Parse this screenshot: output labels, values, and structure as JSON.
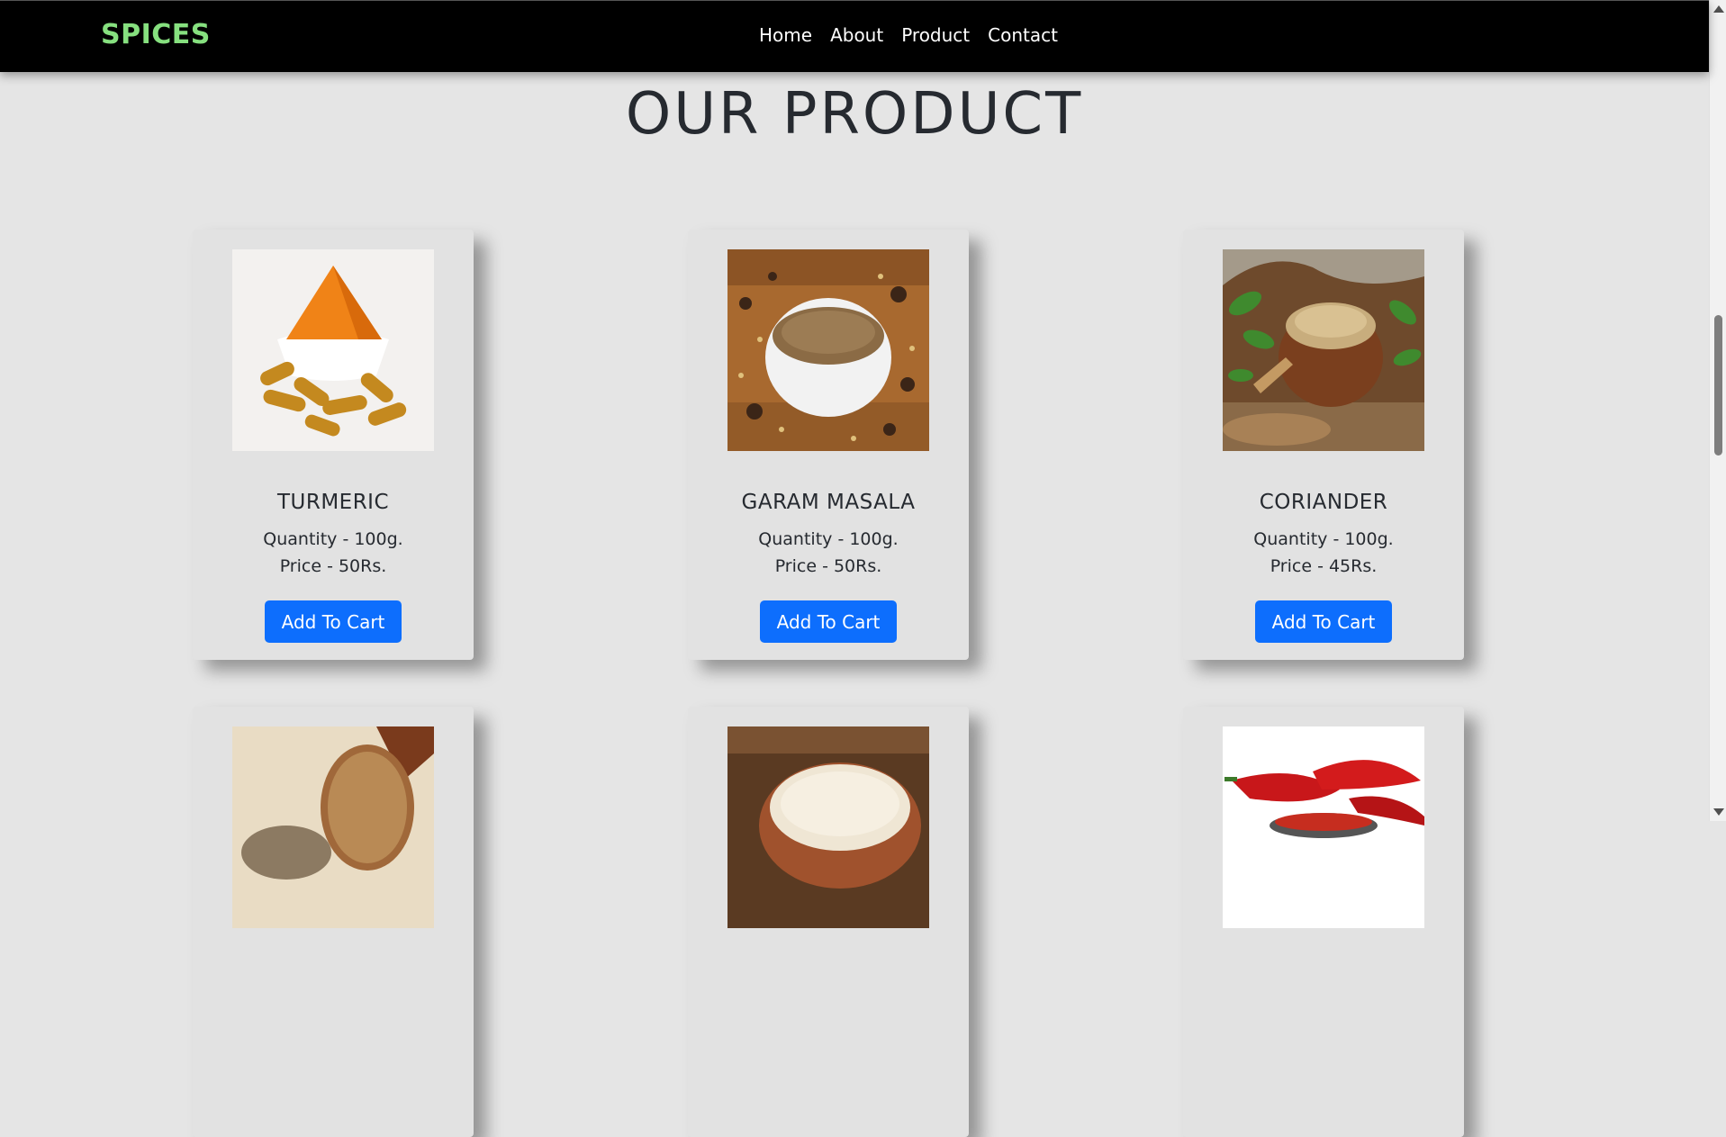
{
  "brand": "SPICES",
  "nav": [
    "Home",
    "About",
    "Product",
    "Contact"
  ],
  "section_title": "OUR PRODUCT",
  "products": [
    {
      "name": "TURMERIC",
      "quantity": "Quantity - 100g.",
      "price": "Price - 50Rs.",
      "button": "Add To Cart",
      "image": "turmeric"
    },
    {
      "name": "GARAM MASALA",
      "quantity": "Quantity - 100g.",
      "price": "Price - 50Rs.",
      "button": "Add To Cart",
      "image": "garam-masala"
    },
    {
      "name": "CORIANDER",
      "quantity": "Quantity - 100g.",
      "price": "Price - 45Rs.",
      "button": "Add To Cart",
      "image": "coriander"
    },
    {
      "name": "",
      "quantity": "",
      "price": "",
      "button": "",
      "image": "cumin-powder"
    },
    {
      "name": "",
      "quantity": "",
      "price": "",
      "button": "",
      "image": "sesame"
    },
    {
      "name": "",
      "quantity": "",
      "price": "",
      "button": "",
      "image": "red-chili"
    }
  ],
  "colors": {
    "navbar": "#000000",
    "brand": "#86e07f",
    "background": "#e5e5e5",
    "button": "#0d6efd"
  }
}
